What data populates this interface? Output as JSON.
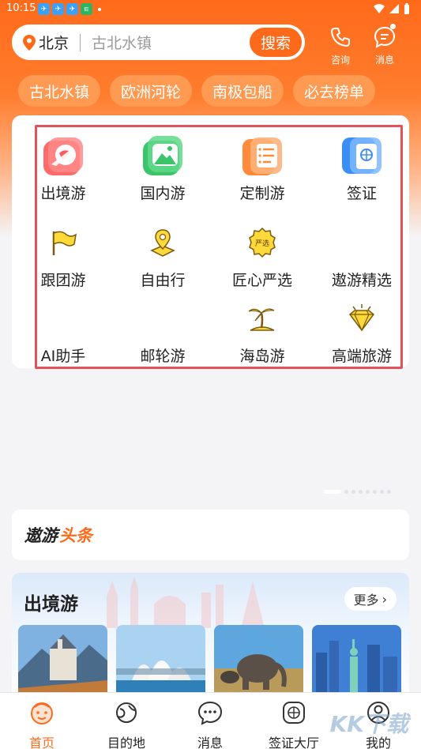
{
  "status": {
    "time": "10:15",
    "app_icons": [
      "app-1",
      "app-2",
      "app-3",
      "app-4"
    ]
  },
  "search": {
    "city": "北京",
    "placeholder": "古北水镇",
    "button": "搜索"
  },
  "top_actions": {
    "consult": "咨询",
    "message": "消息"
  },
  "quick_tags": [
    "古北水镇",
    "欧洲河轮",
    "南极包船",
    "必去榜单"
  ],
  "categories": [
    {
      "label": "出境游",
      "icon": "globe-plane-icon"
    },
    {
      "label": "国内游",
      "icon": "mountain-icon"
    },
    {
      "label": "定制游",
      "icon": "checklist-icon"
    },
    {
      "label": "签证",
      "icon": "passport-icon"
    },
    {
      "label": "跟团游",
      "icon": "flag-icon"
    },
    {
      "label": "自由行",
      "icon": "map-pin-icon"
    },
    {
      "label": "匠心严选",
      "icon": "yanxuan-badge-icon"
    },
    {
      "label": "遨游精选",
      "icon": "blank"
    },
    {
      "label": "AI助手",
      "icon": "blank"
    },
    {
      "label": "邮轮游",
      "icon": "blank"
    },
    {
      "label": "海岛游",
      "icon": "palm-tree-icon"
    },
    {
      "label": "高端旅游",
      "icon": "diamond-icon"
    }
  ],
  "yanxuan_badge_text": "严选",
  "headline": {
    "part1": "遨游",
    "part2": "头条"
  },
  "outbound": {
    "title": "出境游",
    "more": "更多"
  },
  "bottom_nav": [
    {
      "label": "首页",
      "active": true
    },
    {
      "label": "目的地",
      "active": false
    },
    {
      "label": "消息",
      "active": false
    },
    {
      "label": "签证大厅",
      "active": false
    },
    {
      "label": "我的",
      "active": false
    }
  ],
  "watermark": "KK下载",
  "colors": {
    "brand": "#ff6a1a",
    "highlight_frame": "#e1535b"
  }
}
